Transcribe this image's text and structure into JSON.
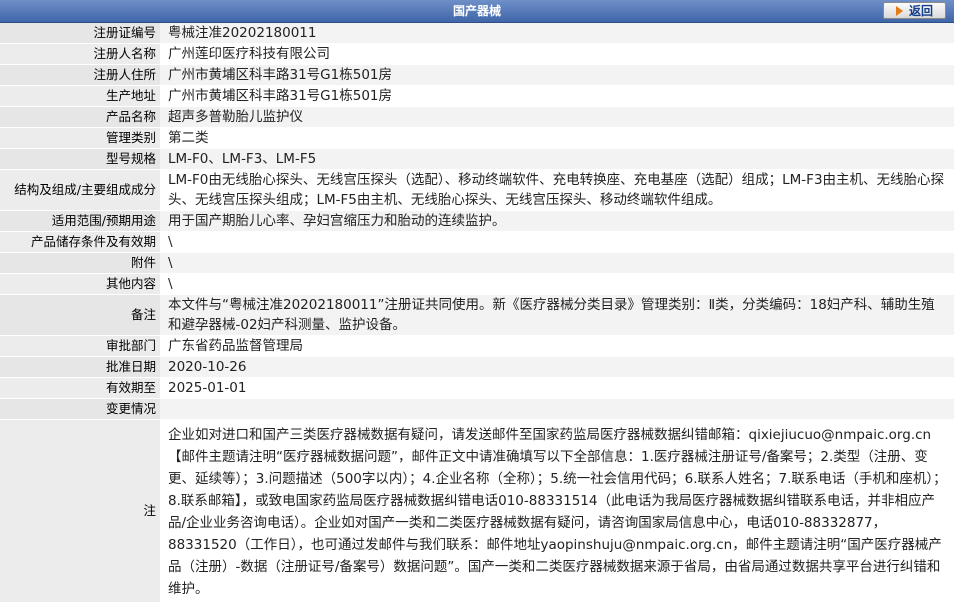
{
  "header": {
    "title": "国产器械",
    "back_label": "返回"
  },
  "rows": [
    {
      "label": "注册证编号",
      "value": "粤械注准20202180011"
    },
    {
      "label": "注册人名称",
      "value": "广州莲印医疗科技有限公司"
    },
    {
      "label": "注册人住所",
      "value": "广州市黄埔区科丰路31号G1栋501房"
    },
    {
      "label": "生产地址",
      "value": "广州市黄埔区科丰路31号G1栋501房"
    },
    {
      "label": "产品名称",
      "value": "超声多普勒胎儿监护仪"
    },
    {
      "label": "管理类别",
      "value": "第二类"
    },
    {
      "label": "型号规格",
      "value": "LM-F0、LM-F3、LM-F5"
    },
    {
      "label": "结构及组成/主要组成成分",
      "value": "LM-F0由无线胎心探头、无线宫压探头（选配）、移动终端软件、充电转换座、充电基座（选配）组成；LM-F3由主机、无线胎心探头、无线宫压探头组成；LM-F5由主机、无线胎心探头、无线宫压探头、移动终端软件组成。"
    },
    {
      "label": "适用范围/预期用途",
      "value": "用于国产期胎儿心率、孕妇宫缩压力和胎动的连续监护。"
    },
    {
      "label": "产品储存条件及有效期",
      "value": "\\"
    },
    {
      "label": "附件",
      "value": "\\"
    },
    {
      "label": "其他内容",
      "value": "\\"
    },
    {
      "label": "备注",
      "value": "本文件与“粤械注准20202180011”注册证共同使用。新《医疗器械分类目录》管理类别：Ⅱ类，分类编码：18妇产科、辅助生殖和避孕器械-02妇产科测量、监护设备。"
    },
    {
      "label": "审批部门",
      "value": "广东省药品监督管理局"
    },
    {
      "label": "批准日期",
      "value": "2020-10-26"
    },
    {
      "label": "有效期至",
      "value": "2025-01-01"
    },
    {
      "label": "变更情况",
      "value": ""
    }
  ],
  "note": {
    "label": "注",
    "text": "企业如对进口和国产三类医疗器械数据有疑问，请发送邮件至国家药监局医疗器械数据纠错邮箱：qixiejiucuo@nmpaic.org.cn【邮件主题请注明“医疗器械数据问题”，邮件正文中请准确填写以下全部信息：1.医疗器械注册证号/备案号；2.类型（注册、变更、延续等）；3.问题描述（500字以内）；4.企业名称（全称）；5.统一社会信用代码；6.联系人姓名；7.联系电话（手机和座机）；8.联系邮箱】，或致电国家药监局医疗器械数据纠错电话010-88331514（此电话为我局医疗器械数据纠错联系电话，并非相应产品/企业业务咨询电话）。企业如对国产一类和二类医疗器械数据有疑问，请咨询国家局信息中心，电话010-88332877，88331520（工作日），也可通过发邮件与我们联系：邮件地址yaopinshuju@nmpaic.org.cn，邮件主题请注明“国产医疗器械产品（注册）-数据（注册证号/备案号）数据问题”。国产一类和二类医疗器械数据来源于省局，由省局通过数据共享平台进行纠错和维护。"
  }
}
